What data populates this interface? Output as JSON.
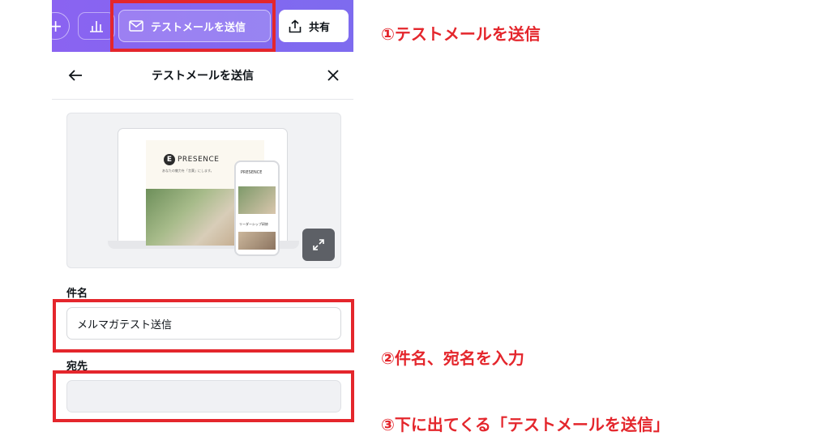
{
  "toolbar": {
    "plus_label": "+",
    "send_test_label": "テストメールを送信",
    "share_label": "共有"
  },
  "panel": {
    "title": "テストメールを送信",
    "preview": {
      "logo_letter": "E",
      "brand": "PRESENCE",
      "tagline": "あなたの魅力を「言葉」にします。",
      "phone_brand": "PRESENCE",
      "phone_caption": "リーダーシップ研修"
    },
    "subject": {
      "label": "件名",
      "value": "メルマガテスト送信"
    },
    "recipient": {
      "label": "宛先",
      "value": ""
    }
  },
  "annotations": {
    "step1": "①テストメールを送信",
    "step2": "②件名、宛名を入力",
    "step3": "③下に出てくる「テストメールを送信」"
  },
  "colors": {
    "toolbar_purple": "#8a63f1",
    "highlight_red": "#e4262c"
  },
  "icons": [
    "plus-icon",
    "bar-chart-icon",
    "envelope-icon",
    "share-upload-icon",
    "back-arrow-icon",
    "close-icon",
    "expand-icon"
  ]
}
